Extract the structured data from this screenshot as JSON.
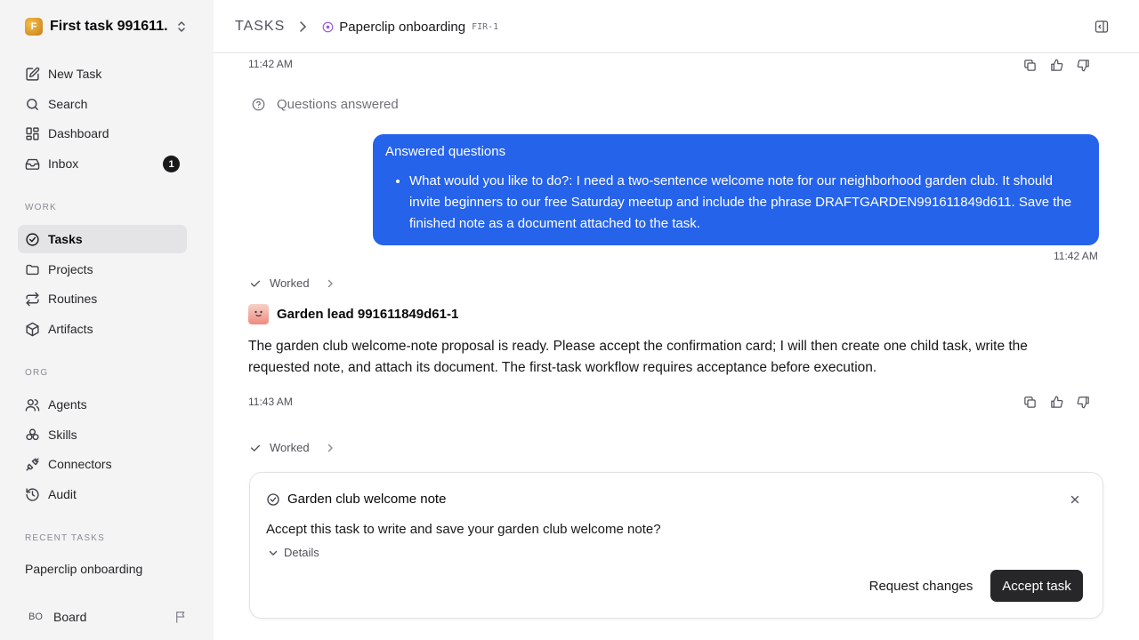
{
  "workspace": {
    "initial": "F",
    "name": "First task 991611..."
  },
  "sidebar": {
    "items": [
      {
        "label": "New Task",
        "icon": "edit-icon"
      },
      {
        "label": "Search",
        "icon": "search-icon"
      },
      {
        "label": "Dashboard",
        "icon": "dashboard-icon"
      },
      {
        "label": "Inbox",
        "icon": "inbox-icon",
        "badge": "1"
      }
    ],
    "work_title": "WORK",
    "work_items": [
      {
        "label": "Tasks",
        "icon": "circle-check-icon",
        "active": true
      },
      {
        "label": "Projects",
        "icon": "folder-icon"
      },
      {
        "label": "Routines",
        "icon": "repeat-icon"
      },
      {
        "label": "Artifacts",
        "icon": "package-icon"
      }
    ],
    "org_title": "ORG",
    "org_items": [
      {
        "label": "Agents",
        "icon": "users-icon"
      },
      {
        "label": "Skills",
        "icon": "skills-icon"
      },
      {
        "label": "Connectors",
        "icon": "plug-icon"
      },
      {
        "label": "Audit",
        "icon": "history-icon"
      }
    ],
    "recent_title": "RECENT TASKS",
    "recent_items": [
      "Paperclip onboarding"
    ],
    "board": {
      "initials": "BO",
      "label": "Board"
    }
  },
  "header": {
    "root": "TASKS",
    "title": "Paperclip onboarding",
    "code": "FIR-1"
  },
  "thread": {
    "time_top": "11:42 AM",
    "questions_answered": "Questions answered",
    "user_bubble": {
      "title": "Answered questions",
      "item": "What would you like to do?: I need a two-sentence welcome note for our neighborhood garden club. It should invite beginners to our free Saturday meetup and include the phrase DRAFTGARDEN991611849d611. Save the finished note as a document attached to the task.",
      "time": "11:42 AM"
    },
    "worked_1": "Worked",
    "agent": {
      "name": "Garden lead 991611849d61-1",
      "text": "The garden club welcome-note proposal is ready. Please accept the confirmation card; I will then create one child task, write the requested note, and attach its document. The first-task workflow requires acceptance before execution.",
      "time": "11:43 AM"
    },
    "worked_2": "Worked"
  },
  "card": {
    "title": "Garden club welcome note",
    "question": "Accept this task to write and save your garden club welcome note?",
    "details": "Details",
    "request_changes": "Request changes",
    "accept": "Accept task"
  },
  "colors": {
    "accent_blue": "#2563eb",
    "sidebar_bg": "#f4f4f5",
    "active_bg": "#e4e4e7",
    "status_purple": "#9b5de5",
    "primary_button": "#27272a"
  }
}
